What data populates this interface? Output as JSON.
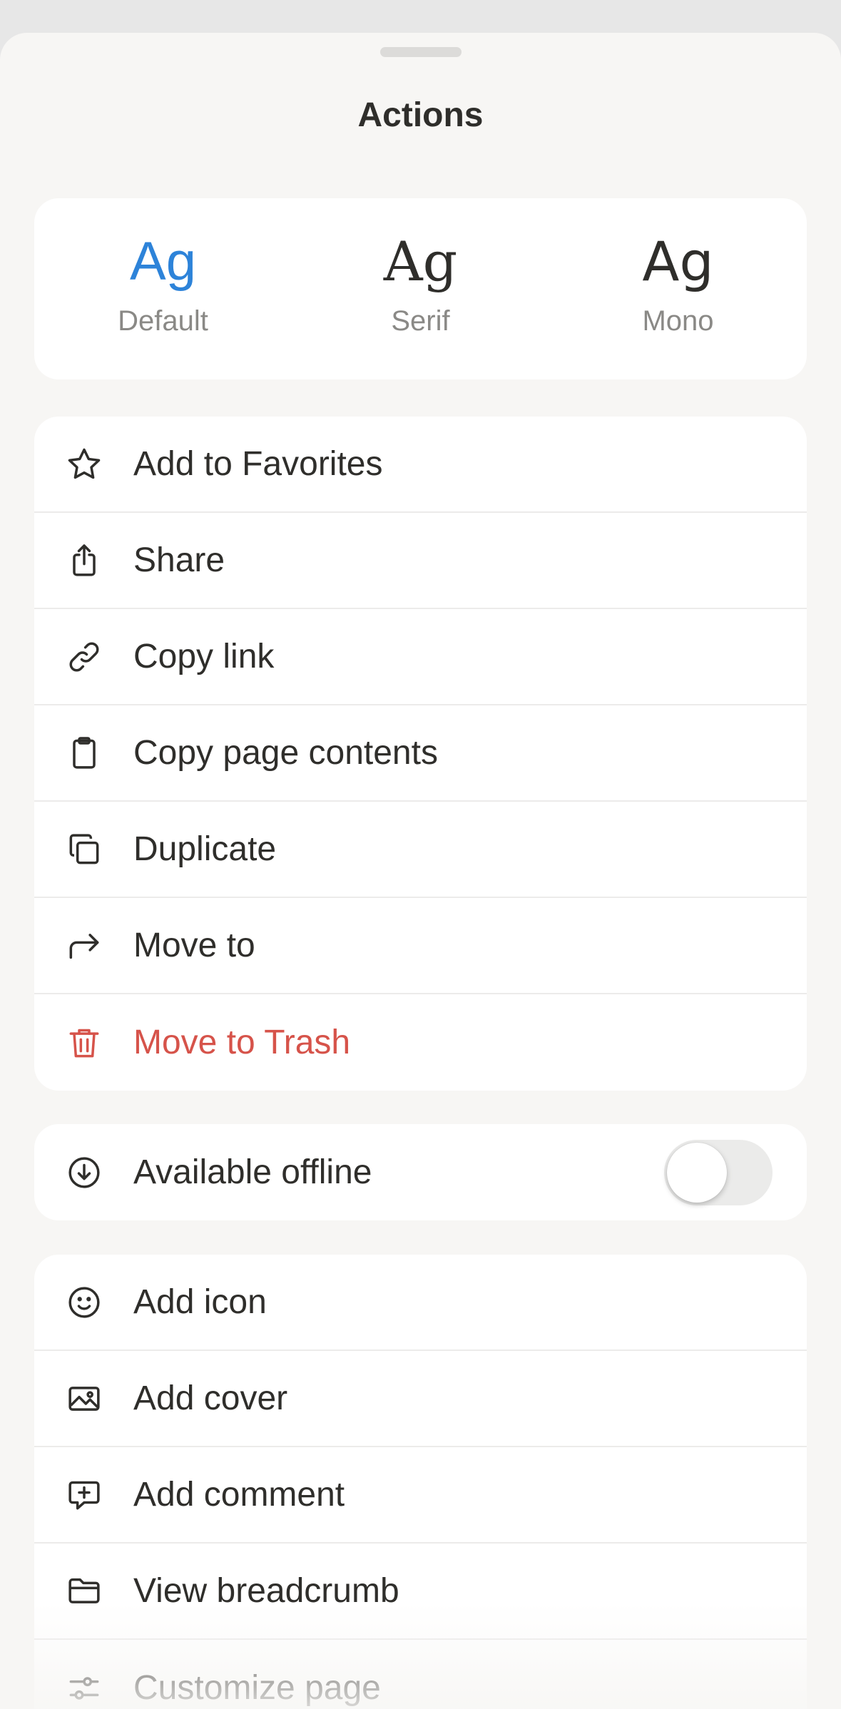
{
  "sheet": {
    "title": "Actions"
  },
  "font_options": [
    {
      "sample": "Ag",
      "name": "Default",
      "selected": true
    },
    {
      "sample": "Ag",
      "name": "Serif",
      "selected": false
    },
    {
      "sample": "Ag",
      "name": "Mono",
      "selected": false
    }
  ],
  "page_actions": [
    {
      "label": "Add to Favorites",
      "icon": "star-icon"
    },
    {
      "label": "Share",
      "icon": "share-icon"
    },
    {
      "label": "Copy link",
      "icon": "link-icon"
    },
    {
      "label": "Copy page contents",
      "icon": "clipboard-icon"
    },
    {
      "label": "Duplicate",
      "icon": "duplicate-icon"
    },
    {
      "label": "Move to",
      "icon": "arrow-turn-right-icon"
    },
    {
      "label": "Move to Trash",
      "icon": "trash-icon"
    }
  ],
  "offline": {
    "label": "Available offline",
    "icon": "download-circle-icon",
    "enabled": false
  },
  "page_extras": [
    {
      "label": "Add icon",
      "icon": "smiley-icon"
    },
    {
      "label": "Add cover",
      "icon": "image-icon"
    },
    {
      "label": "Add comment",
      "icon": "add-comment-icon"
    },
    {
      "label": "View breadcrumb",
      "icon": "folder-icon"
    },
    {
      "label": "Customize page",
      "icon": "sliders-icon"
    }
  ],
  "colors": {
    "accent": "#2d83d9",
    "danger": "#d6534a",
    "text": "#2f2e2b",
    "muted": "#8a8986",
    "sheet_background": "#f7f6f4",
    "card": "#ffffff"
  }
}
